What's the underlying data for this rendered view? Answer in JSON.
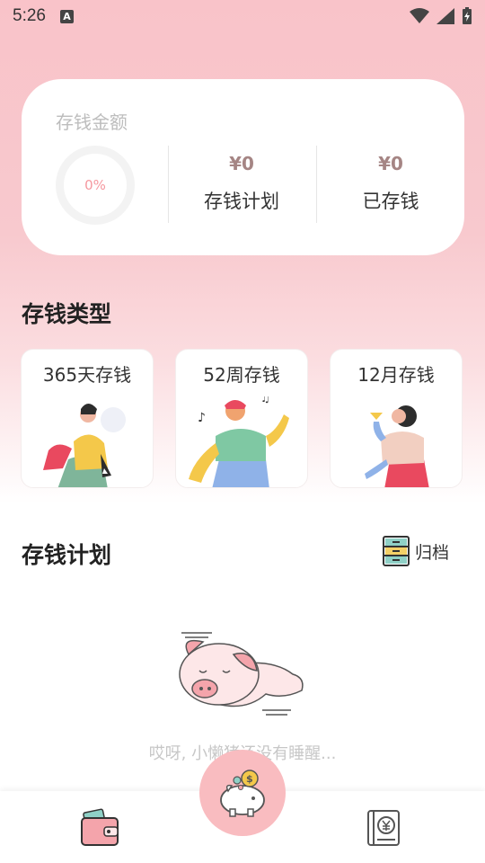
{
  "status_bar": {
    "time": "5:26",
    "notification_icon": "A"
  },
  "summary": {
    "title": "存钱金额",
    "progress_percent": "0%",
    "plan_amount": "¥0",
    "plan_label": "存钱计划",
    "saved_amount": "¥0",
    "saved_label": "已存钱"
  },
  "types_section": {
    "title": "存钱类型",
    "cards": [
      {
        "label": "365天存钱",
        "icon": "person-sitting-illustration"
      },
      {
        "label": "52周存钱",
        "icon": "person-singing-illustration"
      },
      {
        "label": "12月存钱",
        "icon": "person-drinking-illustration"
      }
    ]
  },
  "plan_section": {
    "title": "存钱计划",
    "archive_label": "归档",
    "archive_icon": "file-cabinet-icon",
    "empty_text": "哎呀, 小懒猪还没有睡醒...",
    "empty_icon": "sleeping-pig-icon"
  },
  "bottom_nav": {
    "left_icon": "wallet-icon",
    "center_icon": "piggy-bank-icon",
    "right_icon": "yen-book-icon"
  },
  "colors": {
    "accent_pink": "#f9bcc0",
    "amount_brown": "#a58584",
    "percent_pink": "#f5989f"
  }
}
